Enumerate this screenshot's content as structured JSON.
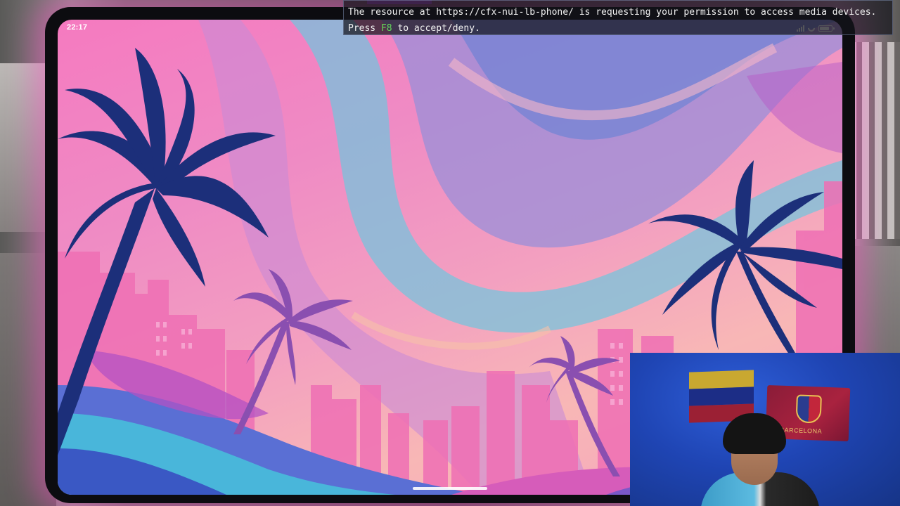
{
  "status_bar": {
    "time": "22:17",
    "icons": [
      "signal-icon",
      "wifi-icon",
      "battery-icon"
    ]
  },
  "notification": {
    "line1": "The resource at https://cfx-nui-lb-phone/ is requesting your permission to access media devices.",
    "line2_prefix": "Press ",
    "line2_key": "F8",
    "line2_suffix": " to accept/deny."
  },
  "webcam": {
    "flag_text": "BARCELONA"
  },
  "colors": {
    "accept_key": "#63d95b",
    "wallpaper_pink": "#f57ac0",
    "palm_navy": "#1c2f7a",
    "palm_purple": "#8a4fb0",
    "frame_glow": "#ff50c8"
  }
}
